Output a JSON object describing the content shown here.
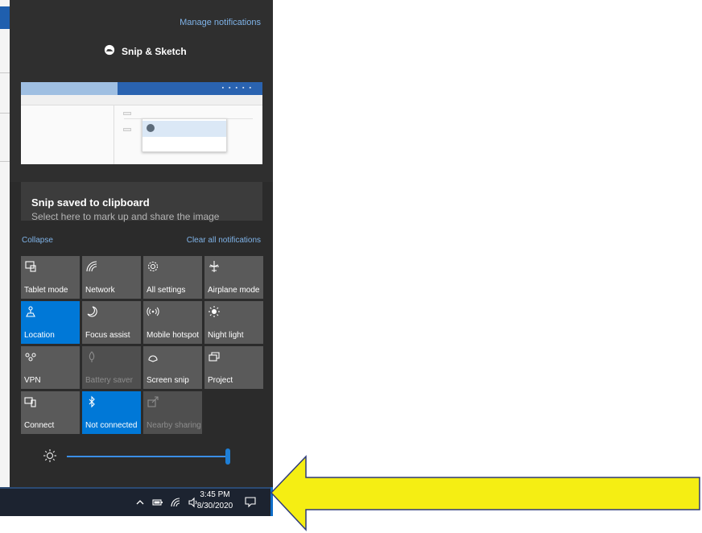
{
  "action_center": {
    "manage_notifications": "Manage notifications",
    "app_name": "Snip & Sketch",
    "toast": {
      "title": "Snip saved to clipboard",
      "subtitle": "Select here to mark up and share the image"
    },
    "collapse": "Collapse",
    "clear_all": "Clear all notifications",
    "tiles": [
      {
        "label": "Tablet mode",
        "icon": "tablet-mode-icon",
        "state": "normal"
      },
      {
        "label": "Network",
        "icon": "network-icon",
        "state": "normal"
      },
      {
        "label": "All settings",
        "icon": "gear-icon",
        "state": "normal"
      },
      {
        "label": "Airplane mode",
        "icon": "airplane-icon",
        "state": "normal"
      },
      {
        "label": "Location",
        "icon": "location-icon",
        "state": "active"
      },
      {
        "label": "Focus assist",
        "icon": "moon-icon",
        "state": "normal"
      },
      {
        "label": "Mobile hotspot",
        "icon": "hotspot-icon",
        "state": "normal"
      },
      {
        "label": "Night light",
        "icon": "sun-icon",
        "state": "normal"
      },
      {
        "label": "VPN",
        "icon": "vpn-icon",
        "state": "normal"
      },
      {
        "label": "Battery saver",
        "icon": "battery-saver-icon",
        "state": "disabled"
      },
      {
        "label": "Screen snip",
        "icon": "screen-snip-icon",
        "state": "normal"
      },
      {
        "label": "Project",
        "icon": "project-icon",
        "state": "normal"
      },
      {
        "label": "Connect",
        "icon": "connect-icon",
        "state": "normal"
      },
      {
        "label": "Not connected",
        "icon": "bluetooth-icon",
        "state": "active"
      },
      {
        "label": "Nearby sharing",
        "icon": "nearby-sharing-icon",
        "state": "disabled"
      }
    ],
    "brightness_percent": 100
  },
  "taskbar": {
    "time": "3:45 PM",
    "date": "8/30/2020"
  },
  "colors": {
    "accent": "#0078d7",
    "link": "#7fb3e8",
    "arrow_fill": "#f5ee13",
    "arrow_stroke": "#2e3a7a"
  }
}
